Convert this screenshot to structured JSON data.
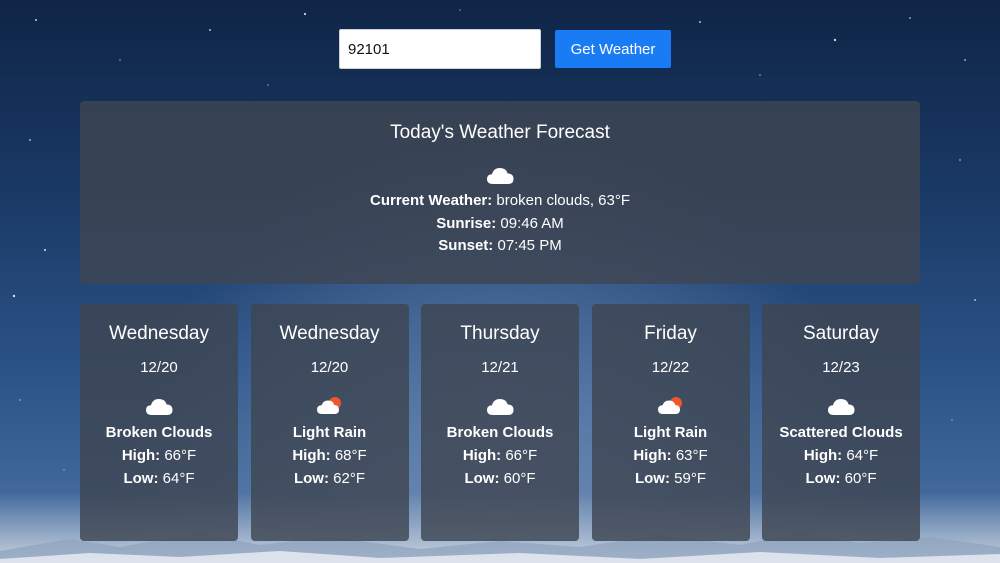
{
  "search": {
    "value": "92101",
    "button_label": "Get Weather"
  },
  "today": {
    "title": "Today's Weather Forecast",
    "icon": "broken-clouds-icon",
    "current_label": "Current Weather:",
    "current_value": "broken clouds, 63°F",
    "sunrise_label": "Sunrise:",
    "sunrise_value": "09:46 AM",
    "sunset_label": "Sunset:",
    "sunset_value": "07:45 PM"
  },
  "labels": {
    "high": "High:",
    "low": "Low:"
  },
  "forecast": [
    {
      "day": "Wednesday",
      "date": "12/20",
      "icon": "broken-clouds-icon",
      "description": "Broken Clouds",
      "high": "66°F",
      "low": "64°F"
    },
    {
      "day": "Wednesday",
      "date": "12/20",
      "icon": "light-rain-icon",
      "description": "Light Rain",
      "high": "68°F",
      "low": "62°F"
    },
    {
      "day": "Thursday",
      "date": "12/21",
      "icon": "broken-clouds-icon",
      "description": "Broken Clouds",
      "high": "66°F",
      "low": "60°F"
    },
    {
      "day": "Friday",
      "date": "12/22",
      "icon": "light-rain-icon",
      "description": "Light Rain",
      "high": "63°F",
      "low": "59°F"
    },
    {
      "day": "Saturday",
      "date": "12/23",
      "icon": "scattered-clouds-icon",
      "description": "Scattered Clouds",
      "high": "64°F",
      "low": "60°F"
    }
  ],
  "colors": {
    "button": "#1a7cf5",
    "panel": "#3e4652",
    "sun": "#f0562e"
  }
}
